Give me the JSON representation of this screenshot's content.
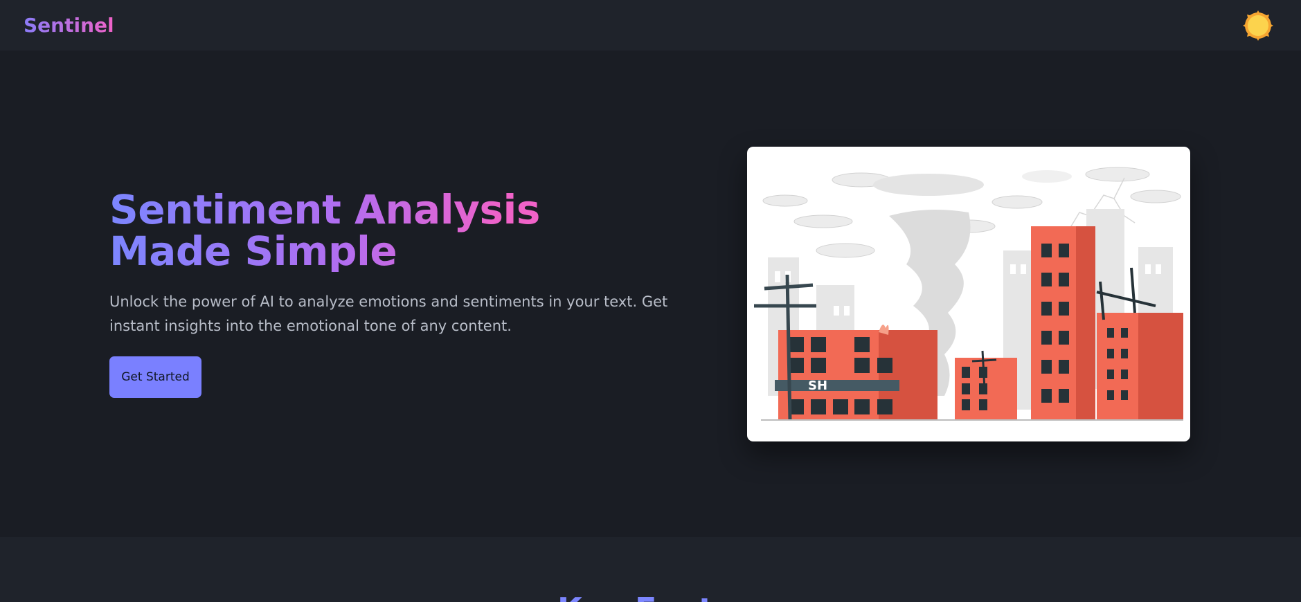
{
  "navbar": {
    "brand": "Sentinel",
    "theme_icon": "sun-icon"
  },
  "hero": {
    "title": "Sentiment Analysis Made Simple",
    "description": "Unlock the power of AI to analyze emotions and sentiments in your text. Get instant insights into the emotional tone of any content.",
    "cta_label": "Get Started",
    "illustration_sign": "SH",
    "illustration_subject": "city-destruction-illustration"
  },
  "next_section": {
    "title": "Key Features"
  },
  "colors": {
    "background": "#1a1d24",
    "navbar": "#1f232b",
    "accent": "#7a80ff",
    "gradient_start": "#7c86ff",
    "gradient_end": "#f062c8",
    "illustration_red": "#f26a55",
    "sun": "#fcd34d"
  }
}
